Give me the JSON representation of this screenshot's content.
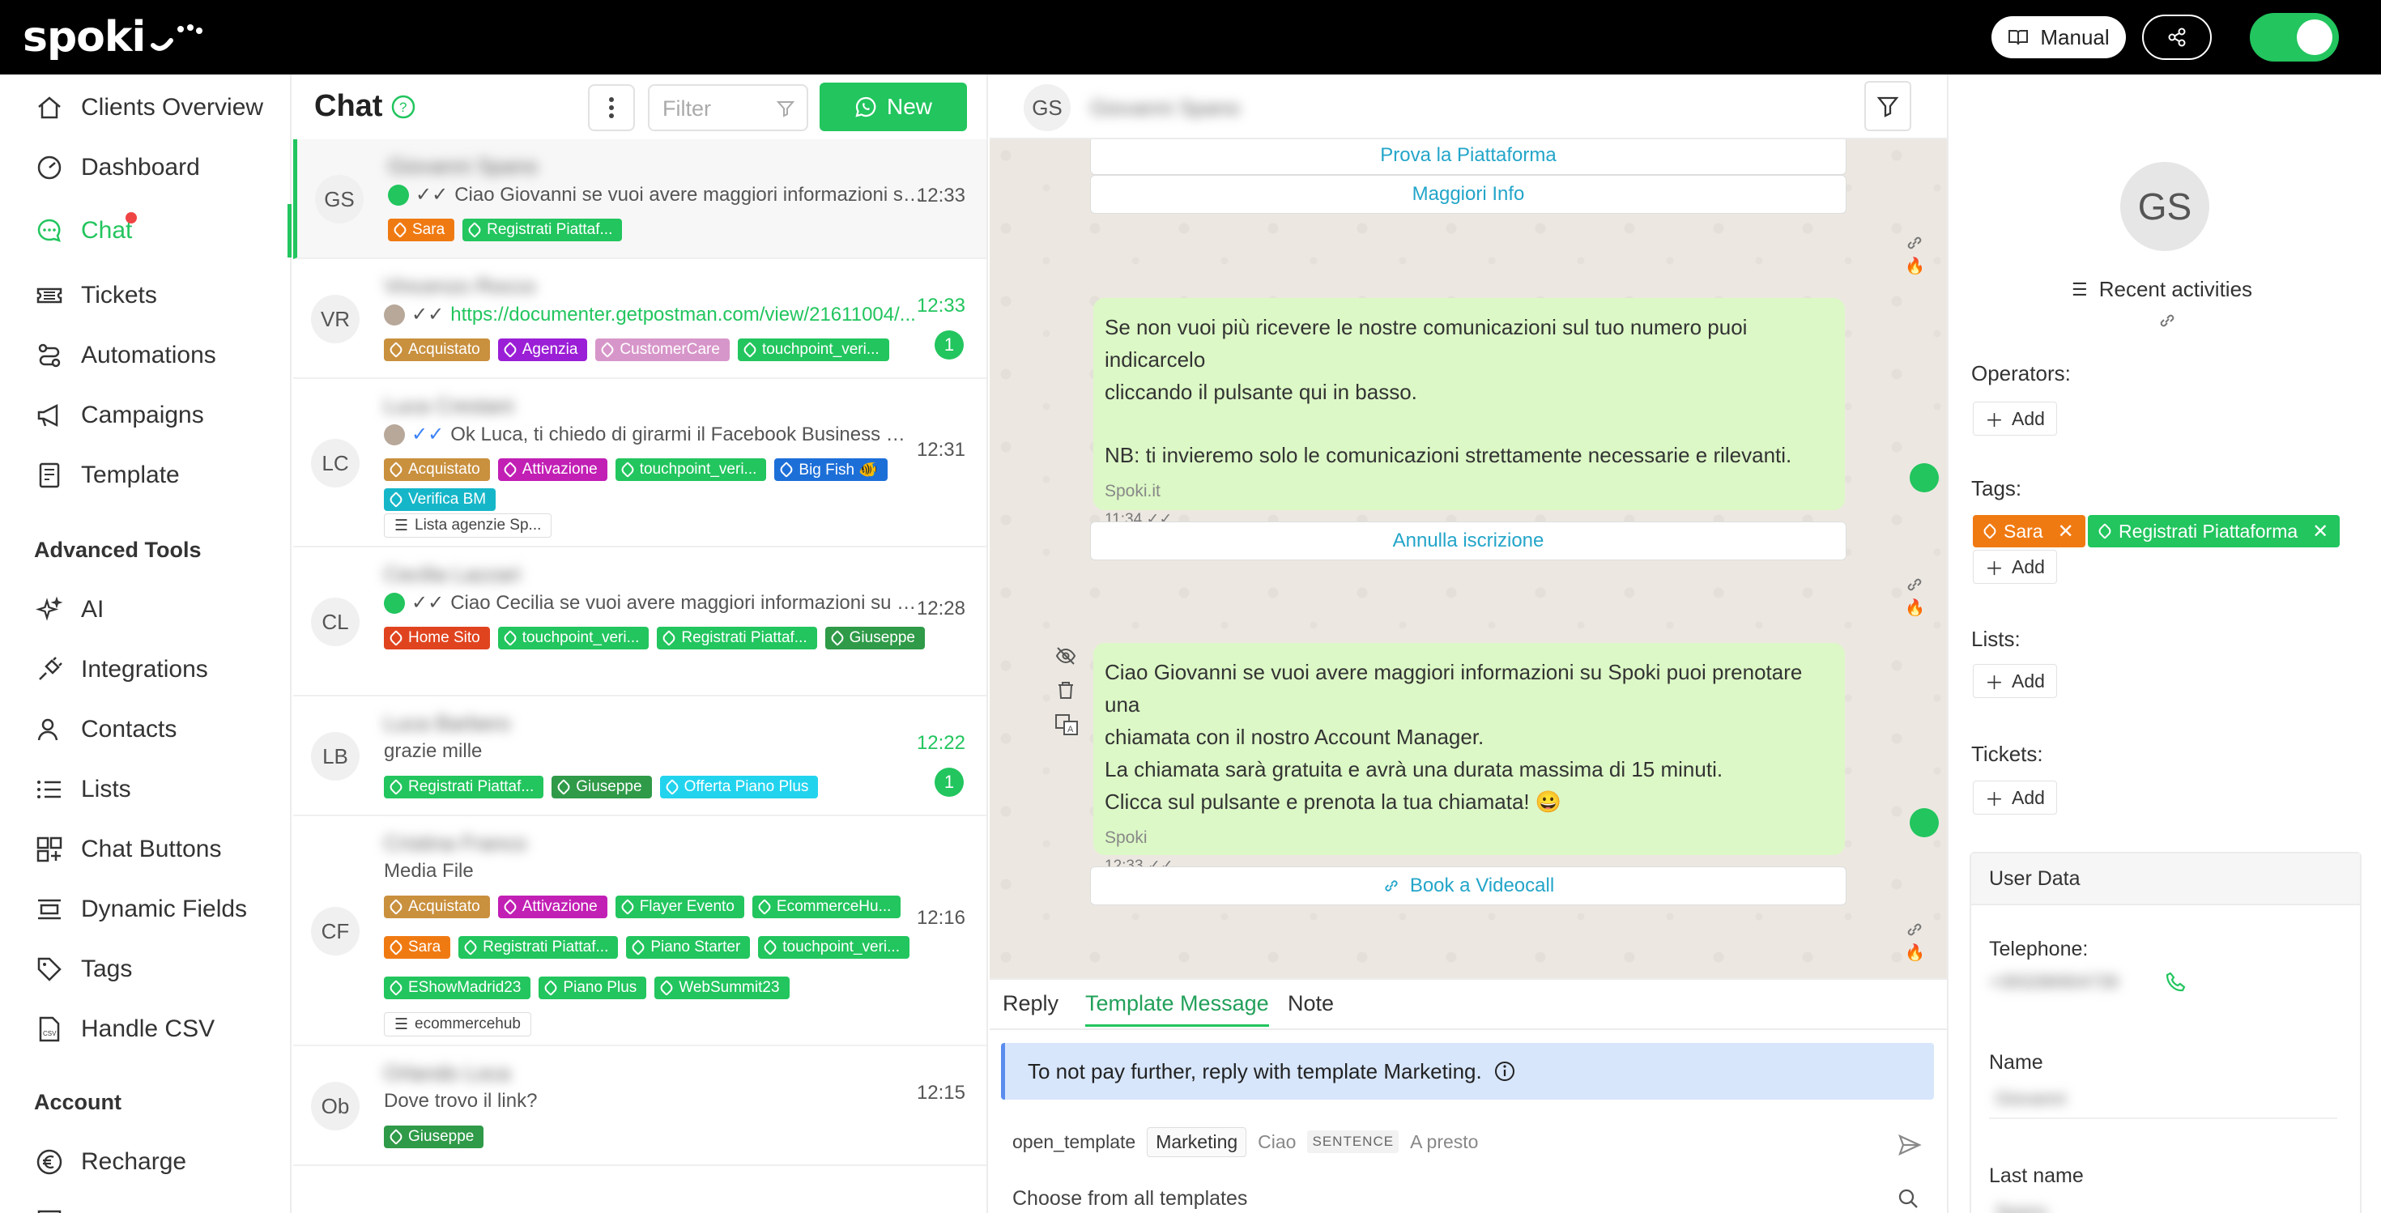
{
  "topbar": {
    "logo_text": "spoki",
    "manual_label": "Manual"
  },
  "sidebar": {
    "items": [
      {
        "label": "Clients Overview",
        "icon": "home-icon"
      },
      {
        "label": "Dashboard",
        "icon": "gauge-icon"
      },
      {
        "label": "Chat",
        "icon": "chat-icon",
        "active": true,
        "notification": true
      },
      {
        "label": "Tickets",
        "icon": "ticket-icon"
      },
      {
        "label": "Automations",
        "icon": "automation-icon"
      },
      {
        "label": "Campaigns",
        "icon": "megaphone-icon"
      },
      {
        "label": "Template",
        "icon": "template-icon"
      }
    ],
    "advanced_heading": "Advanced Tools",
    "advanced_items": [
      {
        "label": "AI",
        "icon": "sparkle-icon"
      },
      {
        "label": "Integrations",
        "icon": "plug-icon"
      },
      {
        "label": "Contacts",
        "icon": "contacts-icon"
      },
      {
        "label": "Lists",
        "icon": "list-icon"
      },
      {
        "label": "Chat Buttons",
        "icon": "buttons-icon"
      },
      {
        "label": "Dynamic Fields",
        "icon": "fields-icon"
      },
      {
        "label": "Tags",
        "icon": "tag-icon"
      },
      {
        "label": "Handle CSV",
        "icon": "csv-file-icon"
      }
    ],
    "account_heading": "Account",
    "account_items": [
      {
        "label": "Recharge",
        "icon": "euro-icon"
      }
    ]
  },
  "chatlist": {
    "title": "Chat",
    "filter_placeholder": "Filter",
    "new_label": "New",
    "conversations": [
      {
        "initials": "GS",
        "name": "Giovanni Spano",
        "preview": "Ciao Giovanni se vuoi avere maggiori informazioni su Spoki ...",
        "time": "12:33",
        "tags": [
          {
            "label": "Sara",
            "color": "#f07a12"
          },
          {
            "label": "Registrati Piattaf...",
            "color": "#22c55e"
          }
        ]
      },
      {
        "initials": "VR",
        "name": "Vincenzo Rocco",
        "preview": "https://documenter.getpostman.com/view/21611004/...",
        "time": "12:33",
        "badge": "1",
        "tags": [
          {
            "label": "Acquistato",
            "color": "#c9903e"
          },
          {
            "label": "Agenzia",
            "color": "#9b1fd6"
          },
          {
            "label": "CustomerCare",
            "color": "#d796c9"
          },
          {
            "label": "touchpoint_veri...",
            "color": "#22c55e"
          }
        ]
      },
      {
        "initials": "LC",
        "name": "Luca Crestani",
        "preview": "Ok Luca, ti chiedo di girarmi il Facebook Business Manager ...",
        "time": "12:31",
        "tags": [
          {
            "label": "Acquistato",
            "color": "#c9903e"
          },
          {
            "label": "Attivazione",
            "color": "#c21fb5"
          },
          {
            "label": "touchpoint_veri...",
            "color": "#22c55e"
          },
          {
            "label": "Big Fish 🐠",
            "color": "#1d6fd8"
          },
          {
            "label": "Verifica BM",
            "color": "#16b6c9"
          }
        ],
        "list": "Lista agenzie Sp..."
      },
      {
        "initials": "CL",
        "name": "Cecilia Lazzari",
        "preview": "Ciao Cecilia se vuoi avere maggiori informazioni su Spoki p...",
        "time": "12:28",
        "tags": [
          {
            "label": "Home Sito",
            "color": "#e0441f"
          },
          {
            "label": "touchpoint_veri...",
            "color": "#22c55e"
          },
          {
            "label": "Registrati Piattaf...",
            "color": "#22c55e"
          },
          {
            "label": "Giuseppe",
            "color": "#2f9a48"
          }
        ]
      },
      {
        "initials": "LB",
        "name": "Luca Barbero",
        "preview": "grazie mille",
        "time": "12:22",
        "badge": "1",
        "tags": [
          {
            "label": "Registrati Piattaf...",
            "color": "#22c55e"
          },
          {
            "label": "Giuseppe",
            "color": "#2f9a48"
          },
          {
            "label": "Offerta Piano Plus",
            "color": "#22d3ee"
          }
        ]
      },
      {
        "initials": "CF",
        "name": "Cristina Franco",
        "preview": "Media File",
        "time": "12:16",
        "tags": [
          {
            "label": "Acquistato",
            "color": "#c9903e"
          },
          {
            "label": "Attivazione",
            "color": "#c21fb5"
          },
          {
            "label": "Flayer Evento",
            "color": "#22c55e"
          },
          {
            "label": "EcommerceHu...",
            "color": "#22c55e"
          },
          {
            "label": "Sara",
            "color": "#f07a12"
          },
          {
            "label": "Registrati Piattaf...",
            "color": "#22c55e"
          },
          {
            "label": "Piano Starter",
            "color": "#22c55e"
          },
          {
            "label": "touchpoint_veri...",
            "color": "#22c55e"
          },
          {
            "label": "EShowMadrid23",
            "color": "#22c55e"
          },
          {
            "label": "Piano Plus",
            "color": "#22c55e"
          },
          {
            "label": "WebSummit23",
            "color": "#22c55e"
          }
        ],
        "list": "ecommercehub"
      },
      {
        "initials": "Ob",
        "name": "Orlando Loca",
        "preview": "Dove trovo il link?",
        "time": "12:15",
        "tags": [
          {
            "label": "Giuseppe",
            "color": "#2f9a48"
          }
        ]
      }
    ]
  },
  "conversation": {
    "initials": "GS",
    "name": "Giovanni Spano",
    "buttons": {
      "prova": "Prova la Piattaforma",
      "info": "Maggiori Info",
      "annulla": "Annulla iscrizione",
      "book": "Book a Videocall"
    },
    "msg1": {
      "line1": "Se non vuoi più ricevere le nostre comunicazioni sul tuo numero puoi indicarcelo",
      "line2": "cliccando il pulsante qui in basso.",
      "line3": "NB: ti invieremo solo le comunicazioni strettamente necessarie e rilevanti.",
      "sender": "Spoki.it",
      "time": "11:34"
    },
    "msg2": {
      "line1": "Ciao Giovanni se vuoi avere maggiori informazioni su Spoki puoi prenotare una",
      "line2": "chiamata con il nostro Account Manager.",
      "line3": "La chiamata sarà gratuita e avrà una durata massima di 15 minuti.",
      "line4": "Clicca sul pulsante e prenota la tua chiamata! 😀",
      "sender": "Spoki",
      "time": "12:33"
    }
  },
  "composer": {
    "tabs": [
      "Reply",
      "Template Message",
      "Note"
    ],
    "info": "To not pay further, reply with template Marketing.",
    "template_name": "open_template",
    "template_category": "Marketing",
    "template_text1": "Ciao",
    "template_var": "SENTENCE",
    "template_text2": "A presto",
    "choose_label": "Choose from all templates"
  },
  "rightpanel": {
    "initials": "GS",
    "recent_label": "Recent activities",
    "operators_label": "Operators:",
    "tags_label": "Tags:",
    "lists_label": "Lists:",
    "tickets_label": "Tickets:",
    "add_label": "Add",
    "tags": [
      {
        "label": "Sara",
        "color": "#f07a12"
      },
      {
        "label": "Registrati Piattaforma",
        "color": "#22c55e"
      }
    ],
    "userdata": {
      "heading": "User Data",
      "telephone_label": "Telephone:",
      "telephone_value": "+393286904739",
      "name_label": "Name",
      "name_value": "Giovanni",
      "lastname_label": "Last name",
      "lastname_value": "Spano"
    }
  }
}
